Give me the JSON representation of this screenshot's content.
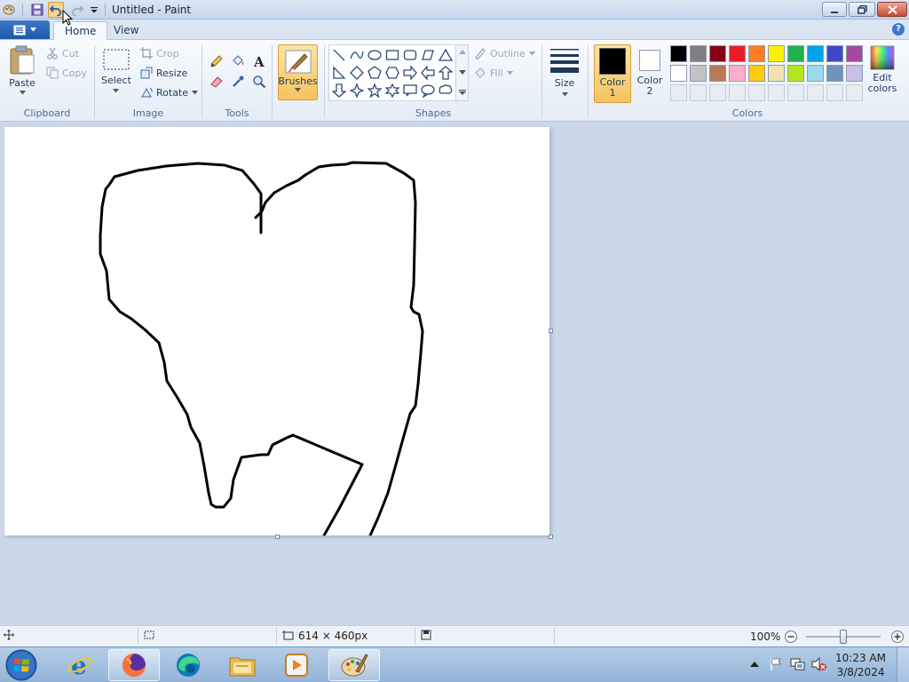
{
  "window": {
    "title": "Untitled - Paint"
  },
  "quick_access": {
    "items": [
      "paint-app-icon",
      "save-icon",
      "undo-icon",
      "redo-icon",
      "customize-dropdown-icon"
    ]
  },
  "tabs": {
    "home": "Home",
    "view": "View"
  },
  "ribbon": {
    "clipboard": {
      "label": "Clipboard",
      "paste": "Paste",
      "cut": "Cut",
      "copy": "Copy"
    },
    "image": {
      "label": "Image",
      "select": "Select",
      "crop": "Crop",
      "resize": "Resize",
      "rotate": "Rotate"
    },
    "tools": {
      "label": "Tools"
    },
    "brushes": {
      "label": "Brushes"
    },
    "shapes": {
      "label": "Shapes",
      "outline": "Outline",
      "fill": "Fill"
    },
    "size": {
      "label": "Size"
    },
    "colors": {
      "label": "Colors",
      "color1": "Color",
      "color1_num": "1",
      "color2": "Color",
      "color2_num": "2",
      "edit": "Edit",
      "edit2": "colors",
      "color1_value": "#000000",
      "color2_value": "#ffffff",
      "palette_row1": [
        "#000000",
        "#7f7f7f",
        "#880015",
        "#ed1c24",
        "#ff7f27",
        "#fff200",
        "#22b14c",
        "#00a2e8",
        "#3f48cc",
        "#a349a4"
      ],
      "palette_row2": [
        "#ffffff",
        "#c3c3c3",
        "#b97a57",
        "#ffaec9",
        "#ffc90e",
        "#efe4b0",
        "#b5e61d",
        "#99d9ea",
        "#7092be",
        "#c8bfe7"
      ]
    }
  },
  "status": {
    "canvas_size": "614 × 460px",
    "zoom": "100%"
  },
  "taskbar": {
    "apps": [
      "internet-explorer-icon",
      "firefox-icon",
      "edge-icon",
      "file-explorer-icon",
      "media-player-icon",
      "paint-icon"
    ],
    "time": "10:23 AM",
    "date": "3/8/2024"
  }
}
